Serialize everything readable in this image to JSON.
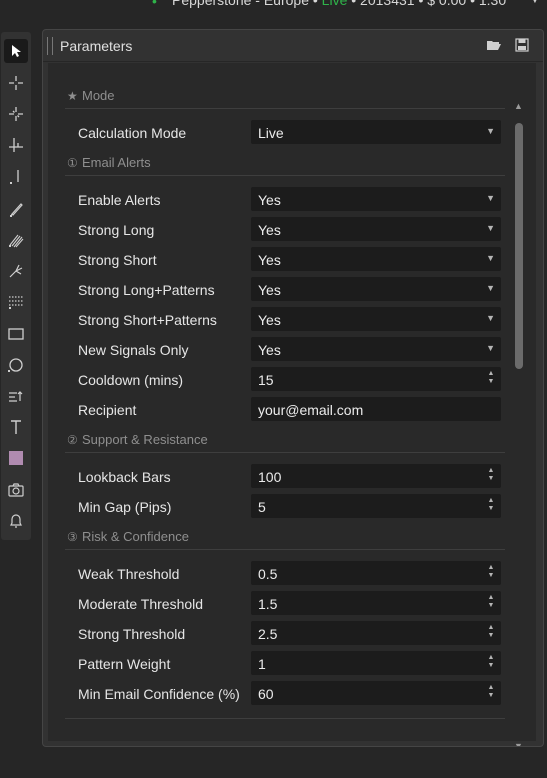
{
  "status": {
    "account_name": "Pepperstone - Europe",
    "separator": " • ",
    "mode": "Live",
    "account_number": "2013431",
    "balance": "$ 0.00",
    "leverage": "1:30",
    "connection_color": "#2fb34a"
  },
  "toolbar": {
    "items": [
      "cursor-icon",
      "crosshair-icon",
      "zoom-icon",
      "measure-icon",
      "vertical-line-icon",
      "pencil-icon",
      "fibonacci-icon",
      "fork-icon",
      "grid-select-icon",
      "rectangle-icon",
      "circle-icon",
      "text-arrow-icon",
      "text-icon",
      "color-swatch-icon",
      "camera-icon",
      "bell-icon"
    ],
    "swatch_color": "#b08bb0"
  },
  "panel": {
    "title": "Parameters"
  },
  "sections": {
    "mode": {
      "icon": "★",
      "title": "Mode",
      "calc_mode": {
        "label": "Calculation Mode",
        "value": "Live"
      }
    },
    "email": {
      "icon": "①",
      "title": "Email Alerts",
      "enable_alerts": {
        "label": "Enable Alerts",
        "value": "Yes"
      },
      "strong_long": {
        "label": "Strong Long",
        "value": "Yes"
      },
      "strong_short": {
        "label": "Strong Short",
        "value": "Yes"
      },
      "strong_long_patterns": {
        "label": "Strong Long+Patterns",
        "value": "Yes"
      },
      "strong_short_patterns": {
        "label": "Strong Short+Patterns",
        "value": "Yes"
      },
      "new_signals_only": {
        "label": "New Signals Only",
        "value": "Yes"
      },
      "cooldown": {
        "label": "Cooldown (mins)",
        "value": "15"
      },
      "recipient": {
        "label": "Recipient",
        "value": "your@email.com"
      }
    },
    "support": {
      "icon": "②",
      "title": "Support & Resistance",
      "lookback": {
        "label": "Lookback Bars",
        "value": "100"
      },
      "min_gap": {
        "label": "Min Gap (Pips)",
        "value": "5"
      }
    },
    "risk": {
      "icon": "③",
      "title": "Risk & Confidence",
      "weak": {
        "label": "Weak Threshold",
        "value": "0.5"
      },
      "moderate": {
        "label": "Moderate Threshold",
        "value": "1.5"
      },
      "strong": {
        "label": "Strong Threshold",
        "value": "2.5"
      },
      "pattern_weight": {
        "label": "Pattern Weight",
        "value": "1"
      },
      "min_email_conf": {
        "label": "Min Email Confidence (%)",
        "value": "60"
      }
    }
  },
  "glyphs": {
    "dropdown": "▼",
    "spin_up": "▲",
    "spin_down": "▼",
    "scroll_up": "▲",
    "scroll_down": "▼",
    "status_dot": "•",
    "menu_chevron": "▼"
  }
}
